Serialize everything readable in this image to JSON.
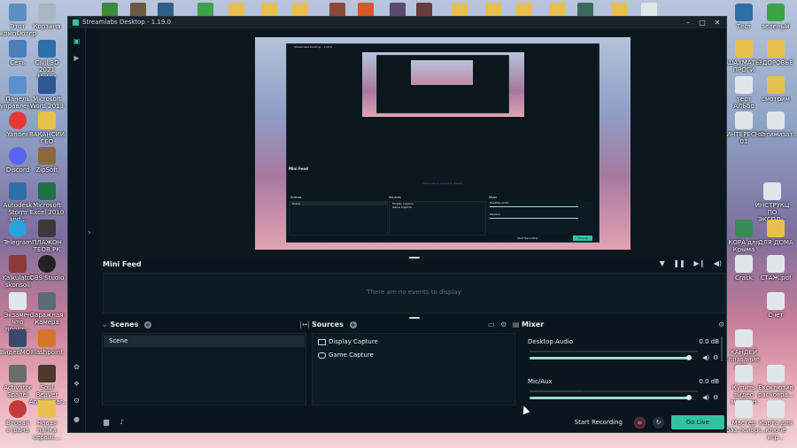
{
  "window": {
    "title": "Streamlabs Desktop - 1.19.0"
  },
  "minifeed": {
    "title": "Mini Feed",
    "empty_text": "There are no events to display"
  },
  "scenes": {
    "title": "Scenes",
    "items": [
      "Scene"
    ]
  },
  "sources": {
    "title": "Sources",
    "items": [
      "Display Capture",
      "Game Capture"
    ]
  },
  "mixer": {
    "title": "Mixer",
    "channels": [
      {
        "name": "Desktop Audio",
        "db": "0.0 dB",
        "volume": 0.98
      },
      {
        "name": "Mic/Aux",
        "db": "0.0 dB",
        "volume": 0.98
      }
    ]
  },
  "footer": {
    "start_recording": "Start Recording",
    "go_live": "Go Live"
  },
  "nested": {
    "title": "Streamlabs Desktop - 1.19.0",
    "minifeed": "Mini Feed",
    "empty": "There are no events to display",
    "scenes": "Scenes",
    "scene": "Scene",
    "sources": "Sources",
    "source1": "Display Capture",
    "source2": "Game Capture",
    "mixer": "Mixer",
    "ch1": "Desktop Audio",
    "ch2": "Mic/Aux",
    "db": "0.0 dB",
    "rec": "Start Recording",
    "live": "Go Live"
  },
  "desktop": {
    "left_icons": [
      "Этот компьютер",
      "Сеть",
      "Панель управления",
      "Yandex",
      "Discord",
      "Autodesk Storm and...",
      "Telegram",
      "Kalkulator skonsoli",
      "Экзамен что прост...",
      "ВидеоМО...",
      "Activator Spanel",
      "Вторая страна"
    ],
    "left_icons2": [
      "Корзина",
      "Civil 3D 2021 Metric",
      "Microsoft Word 2013",
      "ВАКАНСИИ ГЕО",
      "ZipSoft",
      "Microsoft Excel 2010",
      "ПЛАЖОН ТЕОВ.РК",
      "OBS Studio",
      "Заражная Камера",
      "Flashpoint",
      "Soul Reaver Anniversar...",
      "Новая папка сервис..."
    ],
    "right_icons": [
      "Тест",
      "ШАХМАТЫ ПРОГИ",
      "тест АЛЬбо",
      "ИНТЕРЕСНО 01",
      "ИНСТРУКЦ ПО ЭКСПЛ...",
      "КОРА для Крыма",
      "Crack",
      "КАНДЕЙ плавание для...",
      "Купить видео мужчин",
      "Мастер баз.лсиорс..."
    ],
    "right_icons2": [
      "зеленый",
      "ЗДОРОВЬЕ",
      "смотрим",
      "оптимизат...",
      "ДЛЯ ДОМА",
      "СТАЖ.pdf",
      "Счет",
      "Ексклюзив расчовра...",
      "Карта для ключе игр..."
    ]
  }
}
